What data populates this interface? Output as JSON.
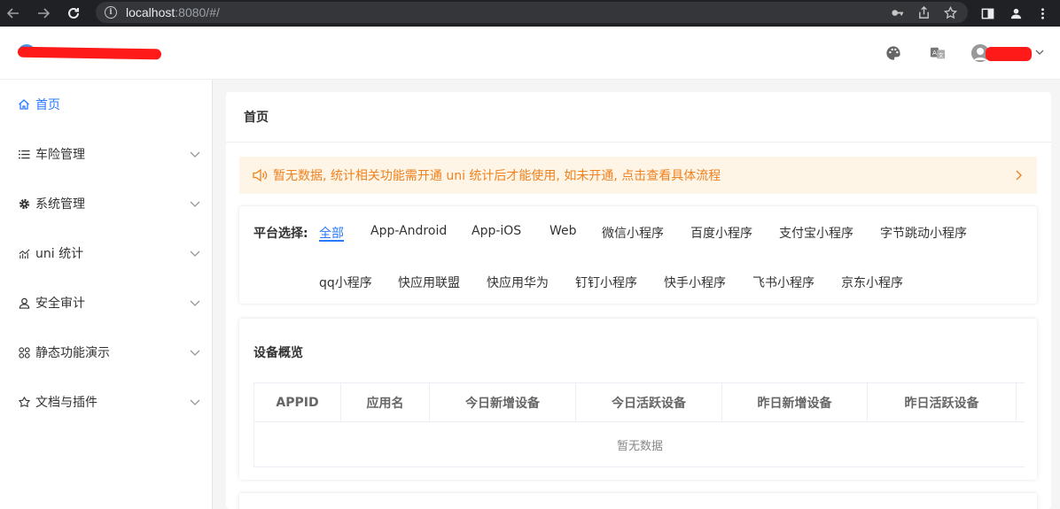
{
  "browser": {
    "url_host": "localhost",
    "url_rest": ":8080/#/"
  },
  "sidebar": {
    "items": [
      {
        "label": "首页",
        "icon": "home-icon",
        "active": true
      },
      {
        "label": "车险管理",
        "icon": "list-icon"
      },
      {
        "label": "系统管理",
        "icon": "gear-icon"
      },
      {
        "label": "uni 统计",
        "icon": "chart-icon"
      },
      {
        "label": "安全审计",
        "icon": "user-icon"
      },
      {
        "label": "静态功能演示",
        "icon": "grid-icon"
      },
      {
        "label": "文档与插件",
        "icon": "plugin-icon"
      }
    ]
  },
  "main": {
    "title": "首页",
    "notice": "暂无数据, 统计相关功能需开通 uni 统计后才能使用, 如未开通, 点击查看具体流程",
    "platform_label": "平台选择:",
    "platforms": [
      "全部",
      "App-Android",
      "App-iOS",
      "Web",
      "微信小程序",
      "百度小程序",
      "支付宝小程序",
      "字节跳动小程序",
      "qq小程序",
      "快应用联盟",
      "快应用华为",
      "钉钉小程序",
      "快手小程序",
      "飞书小程序",
      "京东小程序"
    ],
    "device_title": "设备概览",
    "table": {
      "headers": [
        "APPID",
        "应用名",
        "今日新增设备",
        "今日活跃设备",
        "昨日新增设备",
        "昨日活跃设备"
      ],
      "empty_text": "暂无数据"
    }
  },
  "colors": {
    "accent": "#2979ff",
    "notice_text": "#f0811f",
    "notice_bg": "#fef5e6"
  }
}
